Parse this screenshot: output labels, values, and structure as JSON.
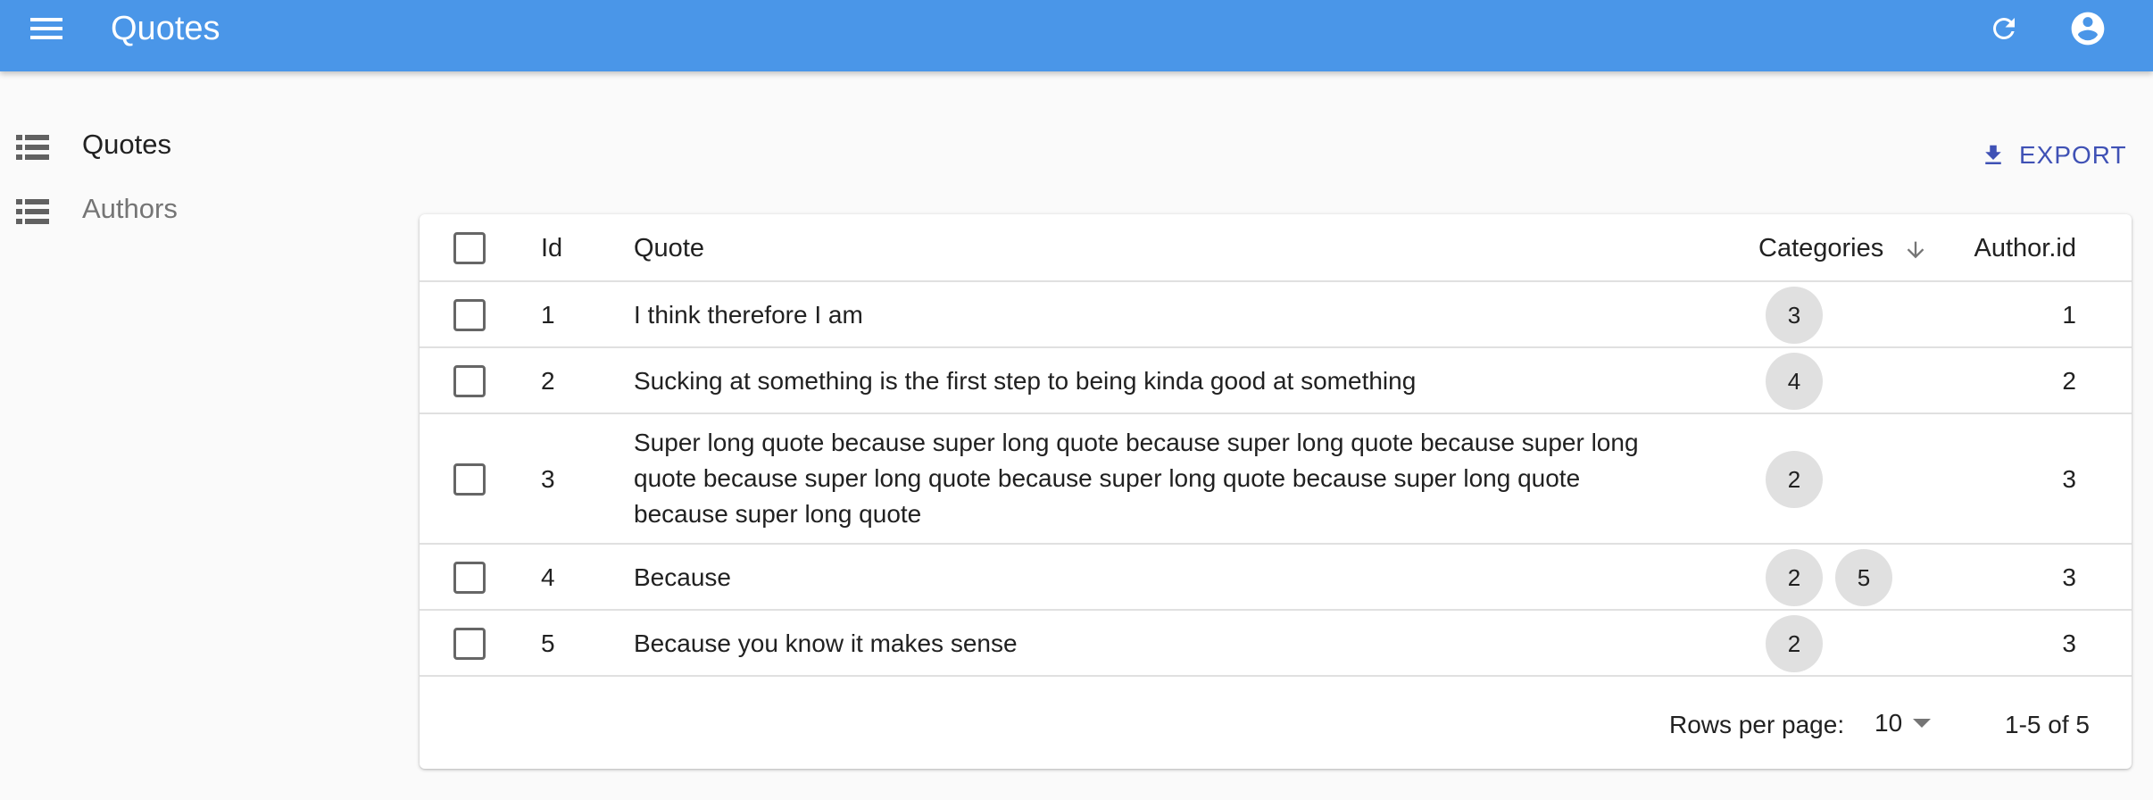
{
  "appbar": {
    "title": "Quotes",
    "menu_icon": "menu-icon",
    "refresh_icon": "refresh-icon",
    "account_icon": "account-circle-icon",
    "color": "#4a96e8"
  },
  "sidebar": {
    "items": [
      {
        "label": "Quotes",
        "icon": "list-icon",
        "active": true
      },
      {
        "label": "Authors",
        "icon": "list-icon",
        "active": false
      }
    ]
  },
  "toolbar": {
    "export_label": "EXPORT",
    "export_icon": "download-icon",
    "accent": "#3f51b5"
  },
  "table": {
    "columns": {
      "id": "Id",
      "quote": "Quote",
      "categories": "Categories",
      "author_id": "Author.id"
    },
    "sort": {
      "column": "Categories",
      "direction": "descending"
    },
    "rows": [
      {
        "id": "1",
        "quote": "I think therefore I am",
        "categories": [
          "3"
        ],
        "author_id": "1"
      },
      {
        "id": "2",
        "quote": "Sucking at something is the first step to being kinda good at something",
        "categories": [
          "4"
        ],
        "author_id": "2"
      },
      {
        "id": "3",
        "quote": "Super long quote because super long quote because super long quote because super long quote because super long quote because super long quote because super long quote because super long quote",
        "categories": [
          "2"
        ],
        "author_id": "3"
      },
      {
        "id": "4",
        "quote": "Because",
        "categories": [
          "2",
          "5"
        ],
        "author_id": "3"
      },
      {
        "id": "5",
        "quote": "Because you know it makes sense",
        "categories": [
          "2"
        ],
        "author_id": "3"
      }
    ]
  },
  "pagination": {
    "rows_per_page_label": "Rows per page:",
    "rows_per_page": "10",
    "range": "1-5 of 5"
  }
}
